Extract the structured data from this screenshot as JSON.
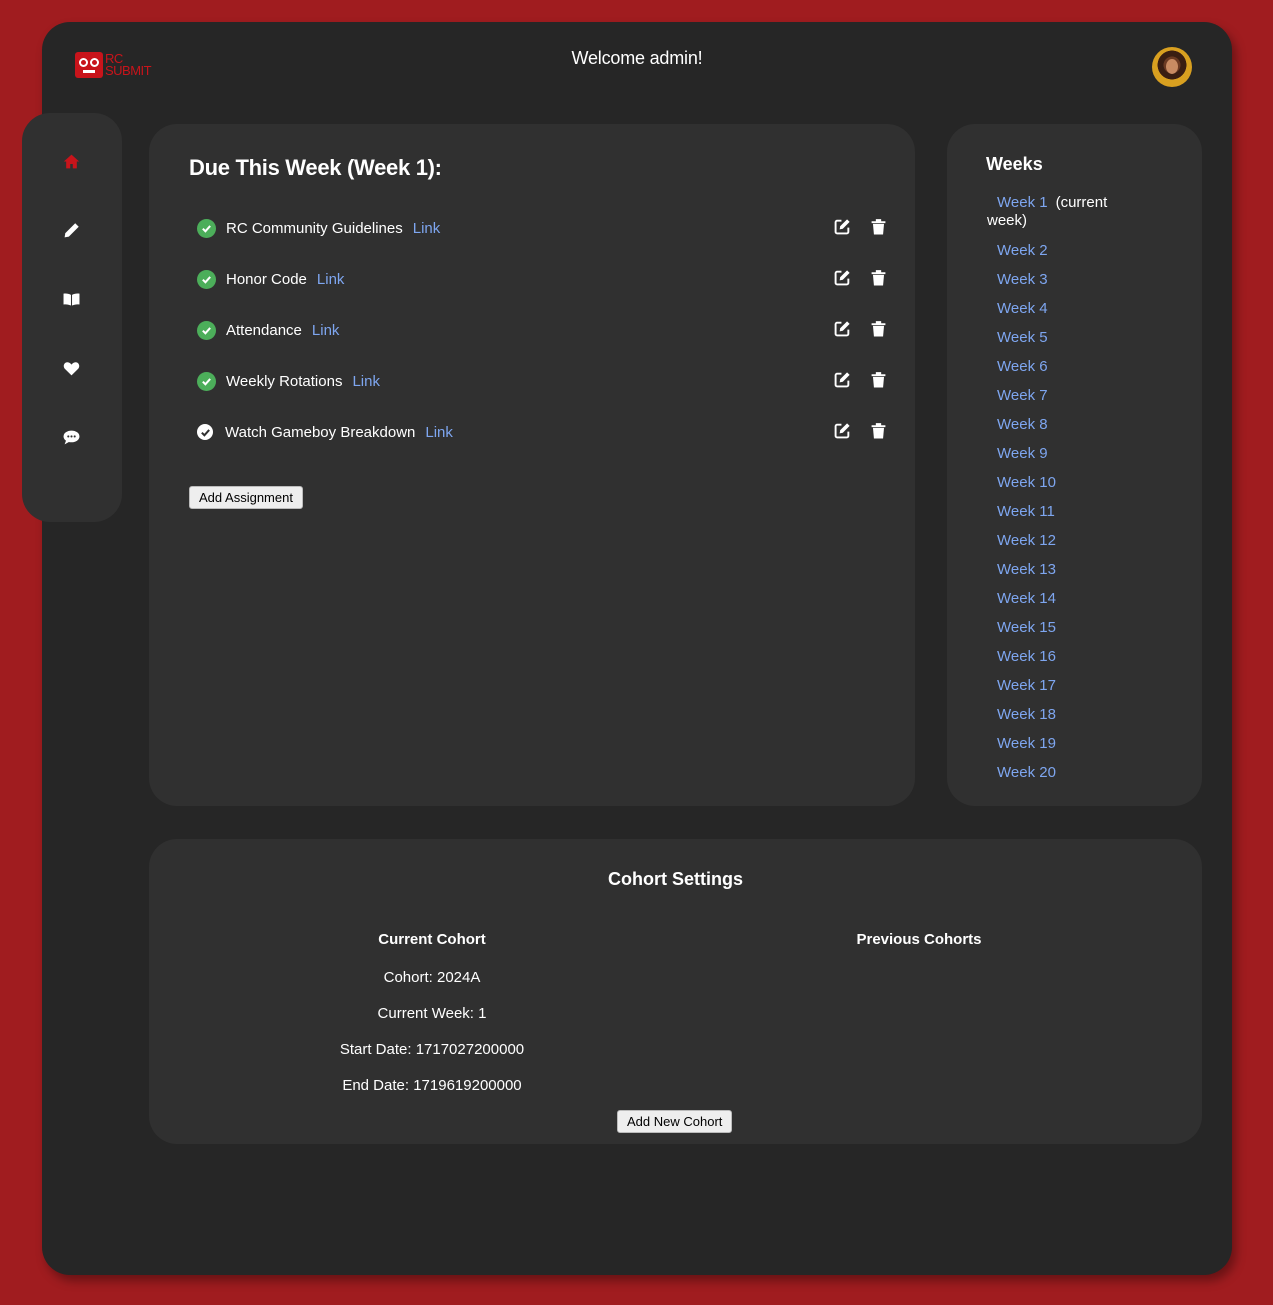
{
  "header": {
    "logo_line1": "RC",
    "logo_line2": "SUBMIT",
    "welcome": "Welcome admin!"
  },
  "sidebar": {
    "items": [
      {
        "icon": "home-icon",
        "active": true
      },
      {
        "icon": "pencil-icon",
        "active": false
      },
      {
        "icon": "book-icon",
        "active": false
      },
      {
        "icon": "heart-icon",
        "active": false
      },
      {
        "icon": "chat-icon",
        "active": false
      }
    ]
  },
  "due": {
    "title": "Due This Week (Week 1):",
    "assignments": [
      {
        "name": "RC Community Guidelines",
        "link": "Link",
        "status": "complete"
      },
      {
        "name": "Honor Code",
        "link": "Link",
        "status": "complete"
      },
      {
        "name": "Attendance",
        "link": "Link",
        "status": "complete"
      },
      {
        "name": "Weekly Rotations",
        "link": "Link",
        "status": "complete"
      },
      {
        "name": "Watch Gameboy Breakdown",
        "link": "Link",
        "status": "pending"
      }
    ],
    "add_button": "Add Assignment"
  },
  "weeks": {
    "title": "Weeks",
    "current_label_1": "(current",
    "current_label_2": "week)",
    "items": [
      "Week 1",
      "Week 2",
      "Week 3",
      "Week 4",
      "Week 5",
      "Week 6",
      "Week 7",
      "Week 8",
      "Week 9",
      "Week 10",
      "Week 11",
      "Week 12",
      "Week 13",
      "Week 14",
      "Week 15",
      "Week 16",
      "Week 17",
      "Week 18",
      "Week 19",
      "Week 20"
    ]
  },
  "cohort": {
    "title": "Cohort Settings",
    "current_heading": "Current Cohort",
    "previous_heading": "Previous Cohorts",
    "cohort": "Cohort: 2024A",
    "current_week": "Current Week: 1",
    "start_date": "Start Date: 1717027200000",
    "end_date": "End Date: 1719619200000",
    "add_button": "Add New Cohort"
  },
  "colors": {
    "background": "#a01c1f",
    "panel": "#262626",
    "card": "#303030",
    "link": "#7ea6f0",
    "check": "#4cae5a",
    "accent": "#c8141b"
  }
}
